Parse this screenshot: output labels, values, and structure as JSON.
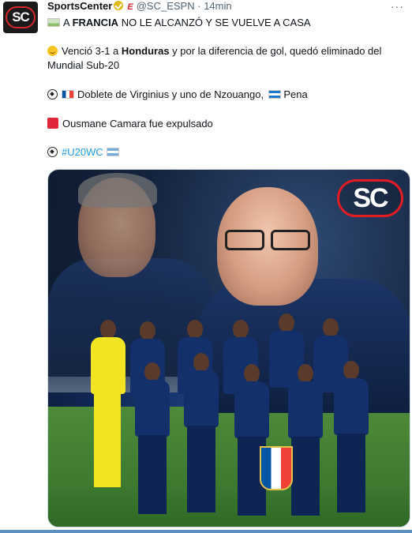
{
  "tweet": {
    "author_name": "SportsCenter",
    "handle": "@SC_ESPN",
    "separator": "·",
    "time": "14min",
    "more_label": "···",
    "avatar_text": "SC",
    "lines": {
      "line1_prefix": "A ",
      "line1_bold": "FRANCIA",
      "line1_rest": " NO LE ALCANZÓ Y SE VUELVE A CASA",
      "line2_a": "Venció 3-1 a ",
      "line2_bold": "Honduras",
      "line2_b": " y por la diferencia de gol, quedó eliminado del",
      "line3": "Mundial Sub-20",
      "line4_a": "Doblete de Virginius y uno de Nzouango,",
      "line4_b": "Pena",
      "line5": "Ousmane Camara fue expulsado",
      "line6_hashtag": "#U20WC"
    }
  },
  "media": {
    "logo_text": "SC",
    "alt": "Foto del equipo de Francia Sub-20 con su entrenador"
  },
  "icons": {
    "verified": "verified-badge-icon",
    "espn": "espn-e-icon",
    "stadium": "stadium-icon",
    "smile": "smile-emoji-icon",
    "ball": "soccer-ball-icon",
    "red_card": "red-card-icon"
  },
  "colors": {
    "link": "#1d9bf0",
    "muted": "#536471",
    "brand_red": "#e31b23"
  }
}
